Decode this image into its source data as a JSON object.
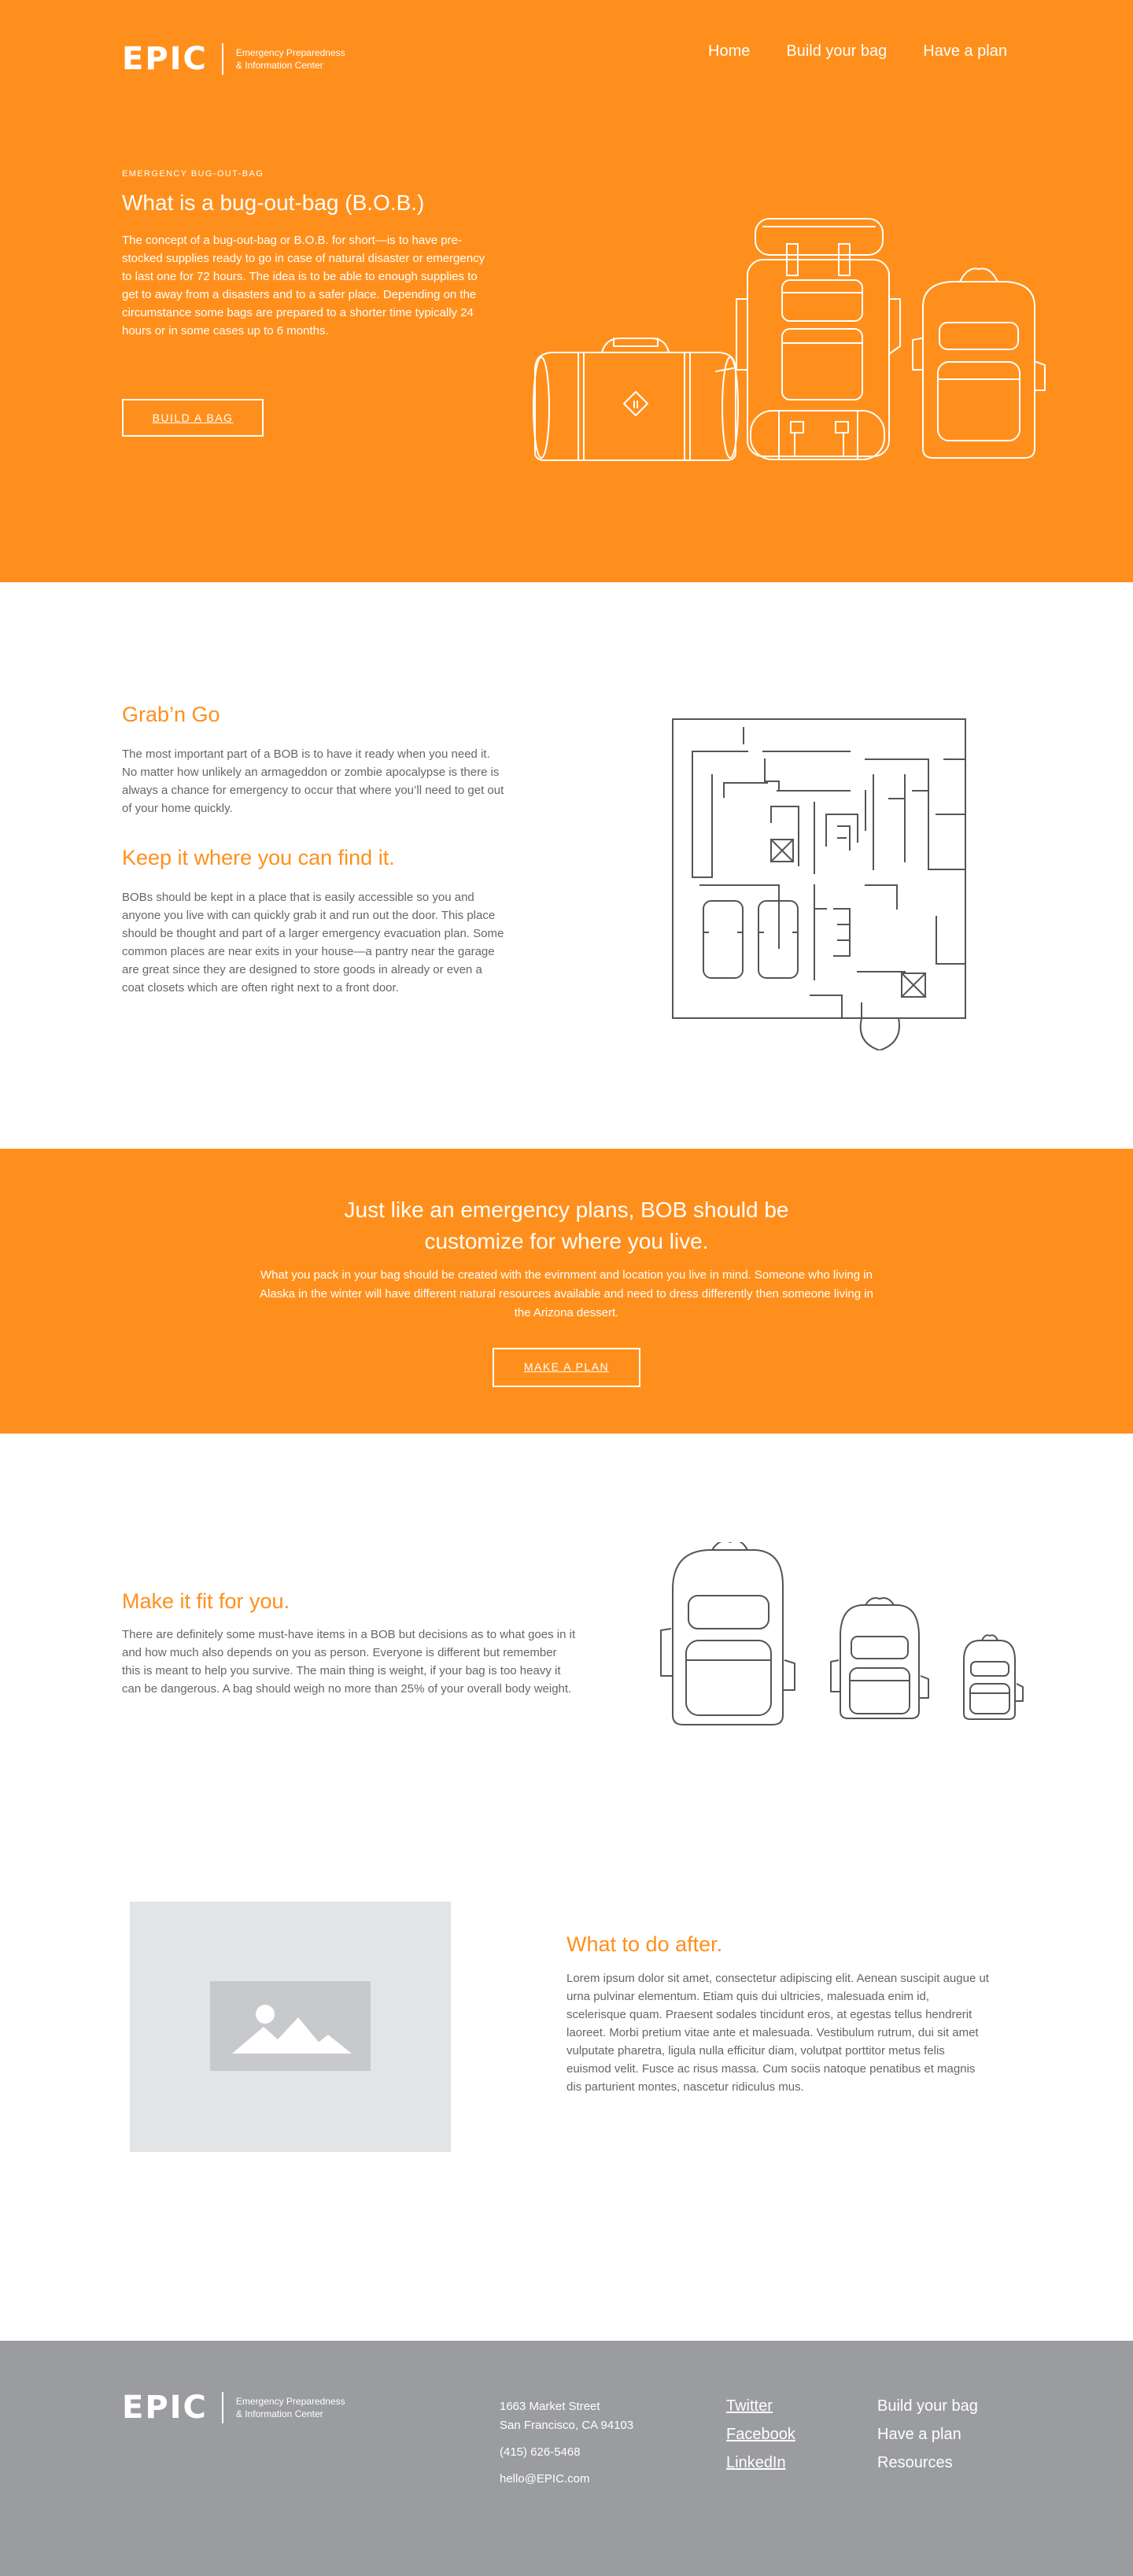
{
  "brand": {
    "logo_word": "EPIC",
    "tagline_line1": "Emergency Preparedness",
    "tagline_line2": "& Information Center"
  },
  "nav": {
    "items": [
      "Home",
      "Build your bag",
      "Have a plan"
    ]
  },
  "hero": {
    "eyebrow": "EMERGENCY BUG-OUT-BAG",
    "title": "What is a bug-out-bag (B.O.B.)",
    "body": "The concept of a bug-out-bag or B.O.B. for short—is to have pre-stocked supplies ready to go in case of natural disaster or emergency to last one for 72 hours. The idea is to be able to enough supplies to get to away from a disasters and to a safer place. Depending on the circumstance some bags are prepared to a shorter time typically 24 hours or in some cases up to 6 months.",
    "button": "BUILD A BAG"
  },
  "grab": {
    "title": "Grab’n Go",
    "body": "The most important part of a BOB is to have it ready when you need it. No matter how unlikely an armageddon or zombie apocalypse is there is always a chance for emergency to occur that where you’ll need to get out of your home quickly."
  },
  "keep": {
    "title": "Keep it where you can find it.",
    "body": "BOBs should be kept in a place that is easily accessible so you and anyone you live with can quickly grab it and run out the door. This place should be thought and part of a larger emergency evacuation plan. Some common places are near exits in your house—a pantry near the garage are great since they are designed to store goods in already or even a coat closets which are often right next to a front door."
  },
  "banner": {
    "title_line1": "Just like an emergency plans, BOB should be",
    "title_line2": "customize for where you live.",
    "body": "What you pack in your bag should be created with the evirnment and location you live in mind. Someone who living in Alaska in the winter will have different natural resources available and need to dress differently then someone living in the Arizona dessert.",
    "button": "MAKE A PLAN"
  },
  "fit": {
    "title": "Make it fit for you.",
    "body": "There are definitely some must-have items in a BOB but decisions as to what goes in it and how much also depends on you as person. Everyone is different but remember this is meant to help you survive. The main thing is weight, if your bag is too heavy it can be dangerous. A bag should weigh no more than 25% of your overall body weight."
  },
  "after": {
    "title": "What to do after.",
    "body": "Lorem ipsum dolor sit amet, consectetur adipiscing elit. Aenean suscipit augue ut urna pulvinar elementum. Etiam quis dui ultricies, malesuada enim id, scelerisque quam. Praesent sodales tincidunt eros, at egestas tellus hendrerit laoreet. Morbi pretium vitae ante et malesuada. Vestibulum rutrum, dui sit amet vulputate pharetra, ligula nulla efficitur diam, volutpat porttitor metus felis euismod velit. Fusce ac risus massa. Cum sociis natoque penatibus et magnis dis parturient montes, nascetur ridiculus mus."
  },
  "footer": {
    "address_line1": "1663 Market Street",
    "address_line2": "San Francisco, CA 94103",
    "phone": "(415) 626-5468",
    "email": "hello@EPIC.com",
    "social": [
      "Twitter",
      "Facebook",
      "LinkedIn"
    ],
    "links": [
      "Build your bag",
      "Have a plan",
      "Resources"
    ]
  },
  "colors": {
    "accent": "#ff8f1c",
    "footer_bg": "#9b9c9f",
    "placeholder_bg": "#e3e4e6"
  },
  "icons": [
    "duffel-bag-icon",
    "large-backpack-icon",
    "daypack-icon",
    "floor-plan-illustration",
    "backpack-size-icons",
    "image-placeholder-icon"
  ]
}
